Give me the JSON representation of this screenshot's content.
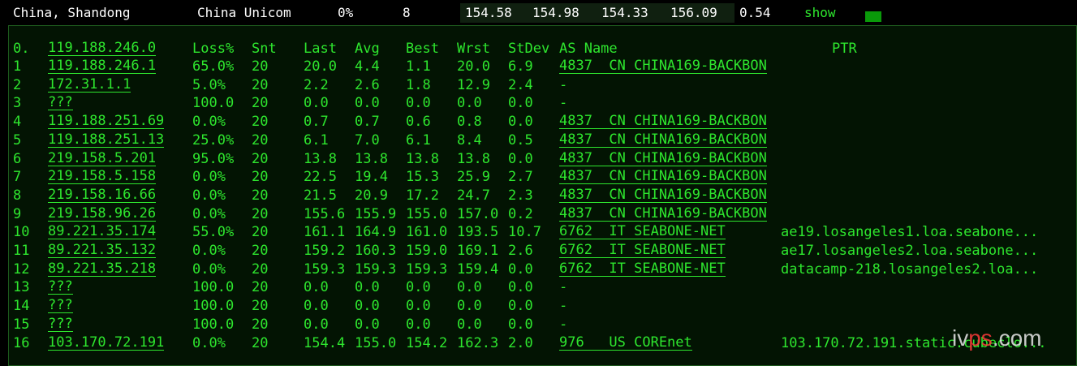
{
  "summary": {
    "location": "China, Shandong",
    "isp": "China Unicom",
    "loss": "0%",
    "sent": "8",
    "last": "154.58",
    "avg": "154.98",
    "best": "154.33",
    "worst": "156.09",
    "stdev": "0.54",
    "show_label": "show"
  },
  "table": {
    "headers": {
      "idx": "0.",
      "host": "119.188.246.0",
      "loss": "Loss%",
      "snt": "Snt",
      "last": "Last",
      "avg": "Avg",
      "best": "Best",
      "wrst": "Wrst",
      "stdev": "StDev",
      "as": "AS Name",
      "ptr": "PTR"
    },
    "rows": [
      {
        "idx": "1",
        "host": "119.188.246.1",
        "loss": "65.0%",
        "snt": "20",
        "last": "20.0",
        "avg": "4.4",
        "best": "1.1",
        "wrst": "20.0",
        "stdev": "6.9",
        "as": "4837  CN CHINA169-BACKBON",
        "ptr": ""
      },
      {
        "idx": "2",
        "host": "172.31.1.1",
        "loss": "5.0%",
        "snt": "20",
        "last": "2.2",
        "avg": "2.6",
        "best": "1.8",
        "wrst": "12.9",
        "stdev": "2.4",
        "as": "-",
        "ptr": ""
      },
      {
        "idx": "3",
        "host": "???",
        "loss": "100.0",
        "snt": "20",
        "last": "0.0",
        "avg": "0.0",
        "best": "0.0",
        "wrst": "0.0",
        "stdev": "0.0",
        "as": "-",
        "ptr": ""
      },
      {
        "idx": "4",
        "host": "119.188.251.69",
        "loss": "0.0%",
        "snt": "20",
        "last": "0.7",
        "avg": "0.7",
        "best": "0.6",
        "wrst": "0.8",
        "stdev": "0.0",
        "as": "4837  CN CHINA169-BACKBON",
        "ptr": ""
      },
      {
        "idx": "5",
        "host": "119.188.251.13",
        "loss": "25.0%",
        "snt": "20",
        "last": "6.1",
        "avg": "7.0",
        "best": "6.1",
        "wrst": "8.4",
        "stdev": "0.5",
        "as": "4837  CN CHINA169-BACKBON",
        "ptr": ""
      },
      {
        "idx": "6",
        "host": "219.158.5.201",
        "loss": "95.0%",
        "snt": "20",
        "last": "13.8",
        "avg": "13.8",
        "best": "13.8",
        "wrst": "13.8",
        "stdev": "0.0",
        "as": "4837  CN CHINA169-BACKBON",
        "ptr": ""
      },
      {
        "idx": "7",
        "host": "219.158.5.158",
        "loss": "0.0%",
        "snt": "20",
        "last": "22.5",
        "avg": "19.4",
        "best": "15.3",
        "wrst": "25.9",
        "stdev": "2.7",
        "as": "4837  CN CHINA169-BACKBON",
        "ptr": ""
      },
      {
        "idx": "8",
        "host": "219.158.16.66",
        "loss": "0.0%",
        "snt": "20",
        "last": "21.5",
        "avg": "20.9",
        "best": "17.2",
        "wrst": "24.7",
        "stdev": "2.3",
        "as": "4837  CN CHINA169-BACKBON",
        "ptr": ""
      },
      {
        "idx": "9",
        "host": "219.158.96.26",
        "loss": "0.0%",
        "snt": "20",
        "last": "155.6",
        "avg": "155.9",
        "best": "155.0",
        "wrst": "157.0",
        "stdev": "0.2",
        "as": "4837  CN CHINA169-BACKBON",
        "ptr": ""
      },
      {
        "idx": "10",
        "host": "89.221.35.174",
        "loss": "55.0%",
        "snt": "20",
        "last": "161.1",
        "avg": "164.9",
        "best": "161.0",
        "wrst": "193.5",
        "stdev": "10.7",
        "as": "6762  IT SEABONE-NET",
        "ptr": "ae19.losangeles1.loa.seabone..."
      },
      {
        "idx": "11",
        "host": "89.221.35.132",
        "loss": "0.0%",
        "snt": "20",
        "last": "159.2",
        "avg": "160.3",
        "best": "159.0",
        "wrst": "169.1",
        "stdev": "2.6",
        "as": "6762  IT SEABONE-NET",
        "ptr": "ae17.losangeles2.loa.seabone..."
      },
      {
        "idx": "12",
        "host": "89.221.35.218",
        "loss": "0.0%",
        "snt": "20",
        "last": "159.3",
        "avg": "159.3",
        "best": "159.3",
        "wrst": "159.4",
        "stdev": "0.0",
        "as": "6762  IT SEABONE-NET",
        "ptr": "datacamp-218.losangeles2.loa..."
      },
      {
        "idx": "13",
        "host": "???",
        "loss": "100.0",
        "snt": "20",
        "last": "0.0",
        "avg": "0.0",
        "best": "0.0",
        "wrst": "0.0",
        "stdev": "0.0",
        "as": "-",
        "ptr": ""
      },
      {
        "idx": "14",
        "host": "???",
        "loss": "100.0",
        "snt": "20",
        "last": "0.0",
        "avg": "0.0",
        "best": "0.0",
        "wrst": "0.0",
        "stdev": "0.0",
        "as": "-",
        "ptr": ""
      },
      {
        "idx": "15",
        "host": "???",
        "loss": "100.0",
        "snt": "20",
        "last": "0.0",
        "avg": "0.0",
        "best": "0.0",
        "wrst": "0.0",
        "stdev": "0.0",
        "as": "-",
        "ptr": ""
      },
      {
        "idx": "16",
        "host": "103.170.72.191",
        "loss": "0.0%",
        "snt": "20",
        "last": "154.4",
        "avg": "155.0",
        "best": "154.2",
        "wrst": "162.3",
        "stdev": "2.0",
        "as": "976   US COREnet",
        "ptr": "103.170.72.191.static.cubeclo..."
      }
    ]
  },
  "watermark": {
    "prefix": "iv",
    "accent": "ps",
    "suffix": ".com"
  }
}
